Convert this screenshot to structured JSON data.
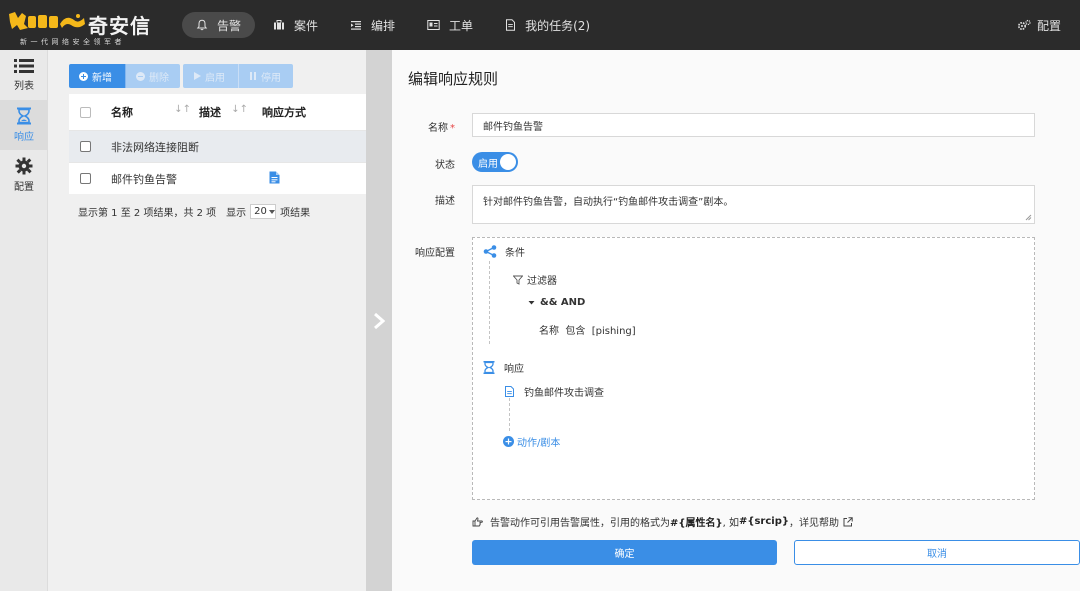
{
  "brand": {
    "name": "奇安信",
    "slogan": "新一代网络安全领军者",
    "accent": "#3a8ee6",
    "logo_color": "#f4b81a"
  },
  "nav": {
    "items": [
      {
        "label": "告警",
        "icon": "bell-icon",
        "active": true
      },
      {
        "label": "案件",
        "icon": "briefcase-icon",
        "active": false
      },
      {
        "label": "编排",
        "icon": "indent-list-icon",
        "active": false
      },
      {
        "label": "工单",
        "icon": "id-card-icon",
        "active": false
      },
      {
        "label": "我的任务(2)",
        "icon": "document-icon",
        "active": false
      }
    ],
    "settings_label": "配置"
  },
  "sidebar": {
    "items": [
      {
        "label": "列表",
        "icon": "list-icon"
      },
      {
        "label": "响应",
        "icon": "hourglass-icon",
        "active": true
      },
      {
        "label": "配置",
        "icon": "gear-icon"
      }
    ]
  },
  "list": {
    "toolbar": {
      "add_label": "新增",
      "delete_label": "删除",
      "enable_label": "启用",
      "disable_label": "停用"
    },
    "columns": [
      "名称",
      "描述",
      "响应方式"
    ],
    "rows": [
      {
        "name": "非法网络连接阻断",
        "description": "",
        "method_icon": ""
      },
      {
        "name": "邮件钓鱼告警",
        "description": "",
        "method_icon": "document-icon"
      }
    ],
    "pager": {
      "summary": "显示第 1 至 2 项结果，共 2 项",
      "show_label": "显示",
      "page_size": "20",
      "suffix": "项结果"
    }
  },
  "edit": {
    "title": "编辑响应规则",
    "name_label": "名称",
    "name_value": "邮件钓鱼告警",
    "status_label": "状态",
    "status_value": "启用",
    "desc_label": "描述",
    "desc_value": "针对邮件钓鱼告警，自动执行“钓鱼邮件攻击调查”剧本。",
    "config_label": "响应配置",
    "config": {
      "condition_label": "条件",
      "filter_label": "过滤器",
      "and_label": "&& AND",
      "rule": "名称  包含  [pishing]",
      "response_label": "响应",
      "playbook": "钓鱼邮件攻击调查",
      "add_action": "动作/剧本"
    },
    "hint": {
      "prefix": "告警动作可引用告警属性，引用的格式为",
      "format": "#{属性名}",
      "middle": ", 如",
      "example": "#{srcip}",
      "suffix": "，详见帮助"
    },
    "ok_label": "确定",
    "cancel_label": "取消"
  }
}
